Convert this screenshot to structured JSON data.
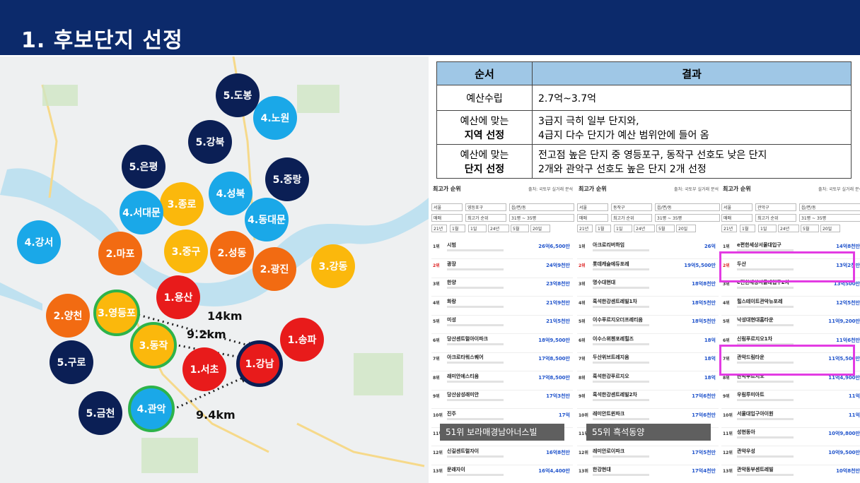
{
  "header": {
    "title": "1. 후보단지 선정"
  },
  "colors": {
    "navy": "#0b1f55",
    "blue": "#1aa8e8",
    "yellow": "#fbb80c",
    "orange": "#f26b12",
    "red": "#e81b1b",
    "green_ring": "#2db34a",
    "header_bg": "#0c2a6b",
    "table_header": "#9fc7e6",
    "highlight": "#e33be3"
  },
  "map": {
    "circles": [
      {
        "label": "5.도봉"
      },
      {
        "label": "4.노원"
      },
      {
        "label": "5.강북"
      },
      {
        "label": "5.은평"
      },
      {
        "label": "5.중랑"
      },
      {
        "label": "4.성북"
      },
      {
        "label": "3.종로"
      },
      {
        "label": "4.서대문"
      },
      {
        "label": "4.동대문"
      },
      {
        "label": "4.강서"
      },
      {
        "label": "2.마포"
      },
      {
        "label": "3.중구"
      },
      {
        "label": "2.성동"
      },
      {
        "label": "2.광진"
      },
      {
        "label": "3.강동"
      },
      {
        "label": "1.용산"
      },
      {
        "label": "2.양천"
      },
      {
        "label": "3.영등포"
      },
      {
        "label": "3.동작"
      },
      {
        "label": "1.송파"
      },
      {
        "label": "5.구로"
      },
      {
        "label": "1.서초"
      },
      {
        "label": "1.강남"
      },
      {
        "label": "5.금천"
      },
      {
        "label": "4.관악"
      }
    ],
    "distances": [
      "14km",
      "9.2km",
      "9.4km"
    ]
  },
  "table": {
    "headers": [
      "순서",
      "결과"
    ],
    "rows": [
      {
        "label_1": "예산수립",
        "label_2": "",
        "value_1": "2.7억~3.7억",
        "value_2": ""
      },
      {
        "label_1": "예산에 맞는",
        "label_2": "지역 선정",
        "value_1": "3급지 극히 일부 단지와,",
        "value_2": "4급지 다수 단지가 예산 범위안에 들어 옴"
      },
      {
        "label_1": "예산에 맞는",
        "label_2": "단지 선정",
        "value_1": "전고점 높은 단지 중 영등포구, 동작구 선호도 낮은 단지",
        "value_2": "2개와 관악구 선호도 높은 단지 2개 선정"
      }
    ]
  },
  "rankings": {
    "columns": [
      {
        "title": "최고가 순위",
        "source": "출처: 국토부 실거래 분석",
        "filters": [
          "서울",
          "영등포구",
          "읍/면/동",
          "매매",
          "최고가 순위",
          "31평 ~ 35평",
          "21년",
          "1월",
          "1일",
          "24년",
          "5월",
          "20일"
        ],
        "rows": [
          {
            "rank": "1위",
            "name": "시범",
            "price": "26억6,500만"
          },
          {
            "rank": "2위",
            "name": "광장",
            "price": "24억9천만"
          },
          {
            "rank": "3위",
            "name": "한양",
            "price": "23억8천만"
          },
          {
            "rank": "4위",
            "name": "화랑",
            "price": "21억9천만"
          },
          {
            "rank": "5위",
            "name": "미성",
            "price": "21억5천만"
          },
          {
            "rank": "6위",
            "name": "당산센트럴아이파크",
            "price": "18억9,500만"
          },
          {
            "rank": "7위",
            "name": "아크로타워스퀘어",
            "price": "17억8,500만"
          },
          {
            "rank": "8위",
            "name": "래미안에스티움",
            "price": "17억8,500만"
          },
          {
            "rank": "9위",
            "name": "당산삼성래미안",
            "price": "17억3천만"
          },
          {
            "rank": "10위",
            "name": "진주",
            "price": "17억"
          },
          {
            "rank": "11위",
            "name": "",
            "price": ""
          },
          {
            "rank": "12위",
            "name": "신길센트럴자이",
            "price": "16억8천만"
          },
          {
            "rank": "13위",
            "name": "문래자이",
            "price": "16억4,400만"
          }
        ],
        "note": "51위 보라매경남아너스빌"
      },
      {
        "title": "최고가 순위",
        "source": "출처: 국토부 실거래 분석",
        "filters": [
          "서울",
          "동작구",
          "읍/면/동",
          "매매",
          "최고가 순위",
          "31평 ~ 35평",
          "21년",
          "1월",
          "1일",
          "24년",
          "5월",
          "20일"
        ],
        "rows": [
          {
            "rank": "1위",
            "name": "아크로리버하임",
            "price": "26억"
          },
          {
            "rank": "2위",
            "name": "롯데캐슬에듀포레",
            "price": "19억5,500만"
          },
          {
            "rank": "3위",
            "name": "명수대현대",
            "price": "18억8천만"
          },
          {
            "rank": "4위",
            "name": "흑석한강센트레빌1차",
            "price": "18억5천만"
          },
          {
            "rank": "5위",
            "name": "이수푸르지오더프레티움",
            "price": "18억5천만"
          },
          {
            "rank": "6위",
            "name": "이수스위첸포레힐즈",
            "price": "18억"
          },
          {
            "rank": "7위",
            "name": "두산위브트레지움",
            "price": "18억"
          },
          {
            "rank": "8위",
            "name": "흑석한강푸르지오",
            "price": "18억"
          },
          {
            "rank": "9위",
            "name": "흑석한강센트레빌2차",
            "price": "17억6천만"
          },
          {
            "rank": "10위",
            "name": "래미안트윈파크",
            "price": "17억6천만"
          },
          {
            "rank": "11위",
            "name": "",
            "price": ""
          },
          {
            "rank": "12위",
            "name": "래미안로이파크",
            "price": "17억5천만"
          },
          {
            "rank": "13위",
            "name": "한강현대",
            "price": "17억4천만"
          }
        ],
        "note": "55위 흑석동양"
      },
      {
        "title": "최고가 순위",
        "source": "출처: 국토부 실거래 분석",
        "filters": [
          "서울",
          "관악구",
          "읍/면/동",
          "매매",
          "최고가 순위",
          "31평 ~ 35평",
          "21년",
          "1월",
          "1일",
          "24년",
          "5월",
          "20일"
        ],
        "rows": [
          {
            "rank": "1위",
            "name": "e편한세상서울대입구",
            "price": "14억8천만"
          },
          {
            "rank": "2위",
            "name": "두산",
            "price": "13억2천만"
          },
          {
            "rank": "3위",
            "name": "e편한세상서울대입구2차",
            "price": "13억500만"
          },
          {
            "rank": "4위",
            "name": "힐스테이트관악뉴포레",
            "price": "12억5천만"
          },
          {
            "rank": "5위",
            "name": "낙성대현대홈타운",
            "price": "11억9,200만"
          },
          {
            "rank": "6위",
            "name": "신림푸르지오1차",
            "price": "11억6천만"
          },
          {
            "rank": "7위",
            "name": "관악드림타운",
            "price": "11억5,500만"
          },
          {
            "rank": "8위",
            "name": "관악푸르지오",
            "price": "11억4,900만"
          },
          {
            "rank": "9위",
            "name": "우림루미아트",
            "price": "11억"
          },
          {
            "rank": "10위",
            "name": "서울대입구아이원",
            "price": "11억"
          },
          {
            "rank": "11위",
            "name": "성현동아",
            "price": "10억9,800만"
          },
          {
            "rank": "12위",
            "name": "관악우성",
            "price": "10억9,500만"
          },
          {
            "rank": "13위",
            "name": "관악동부센트레빌",
            "price": "10억8천만"
          }
        ],
        "note": ""
      }
    ]
  }
}
